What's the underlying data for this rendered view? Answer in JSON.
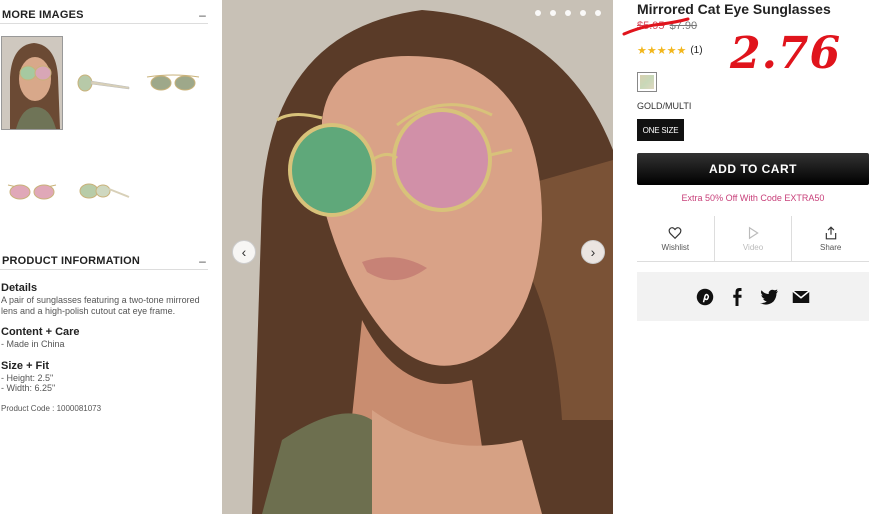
{
  "more_images": {
    "heading": "MORE IMAGES",
    "collapse_symbol": "–"
  },
  "product_information": {
    "heading": "PRODUCT INFORMATION",
    "collapse_symbol": "–",
    "details_title": "Details",
    "details_text": "A pair of sunglasses featuring a two-tone mirrored lens and a high-polish cutout cat eye frame.",
    "content_title": "Content + Care",
    "content_text": "- Made in China",
    "size_title": "Size + Fit",
    "size_height": "- Height: 2.5\"",
    "size_width": "- Width: 6.25\"",
    "product_code": "Product Code : 1000081073"
  },
  "carousel": {
    "prev_icon": "‹",
    "next_icon": "›"
  },
  "product": {
    "title": "Mirrored Cat Eye Sunglasses",
    "sale_price": "$5.95",
    "original_price": "$7.90",
    "annotated_price": "2.76",
    "stars": "★★★★★",
    "review_count": "(1)",
    "color_name": "GOLD/MULTI",
    "size_label": "ONE SIZE",
    "add_to_cart": "ADD TO CART",
    "promo": "Extra 50% Off With Code EXTRA50"
  },
  "actions": [
    {
      "label": "Wishlist",
      "icon": "heart-icon"
    },
    {
      "label": "Video",
      "icon": "play-icon"
    },
    {
      "label": "Share",
      "icon": "share-icon"
    }
  ],
  "social": [
    "pinterest-icon",
    "facebook-icon",
    "twitter-icon",
    "email-icon"
  ],
  "colors": {
    "sale": "#d64a5a",
    "promo": "#c8407a",
    "annotation": "#e0141c",
    "stars": "#f2b61b"
  }
}
